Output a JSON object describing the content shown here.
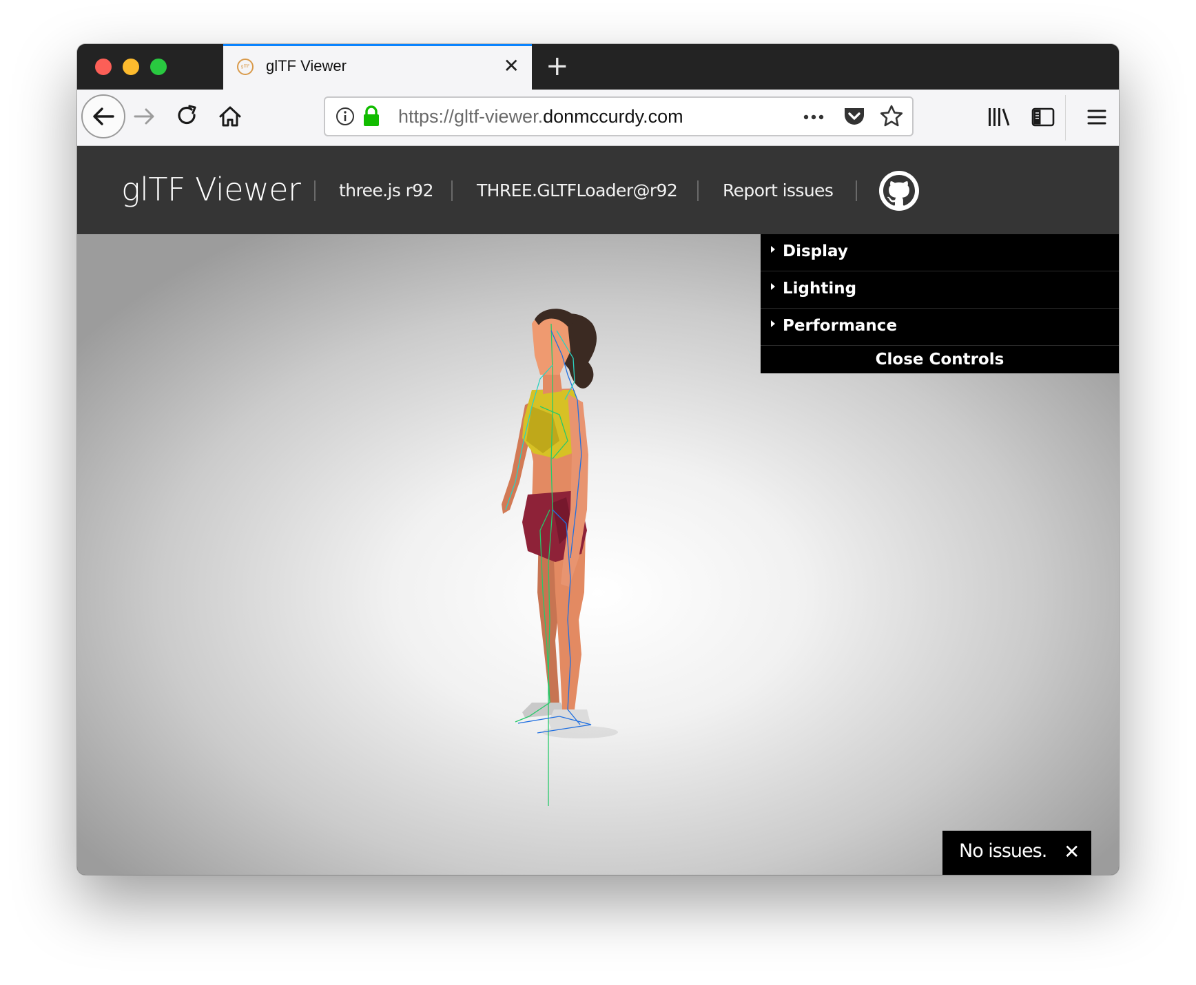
{
  "browser": {
    "tab": {
      "title": "glTF Viewer",
      "favicon_text": "glTF",
      "close_glyph": "✕"
    },
    "new_tab_glyph": "+",
    "url": {
      "prefix": "https://gltf-viewer.",
      "domain": "donmccurdy.com"
    },
    "toolbar_icons": [
      "back-arrow-icon",
      "forward-arrow-icon",
      "reload-icon",
      "home-icon",
      "info-icon",
      "lock-icon",
      "page-actions-icon",
      "pocket-icon",
      "bookmark-star-icon",
      "library-icon",
      "sidebar-icon",
      "menu-icon"
    ]
  },
  "site": {
    "title": "glTF Viewer",
    "nav": {
      "threejs": "three.js r92",
      "loader": "THREE.GLTFLoader@r92",
      "issues": "Report issues"
    }
  },
  "controls": {
    "folders": [
      "Display",
      "Lighting",
      "Performance"
    ],
    "close_label": "Close Controls"
  },
  "toast": {
    "message": "No issues.",
    "close_glyph": "✕"
  },
  "colors": {
    "tab_accent": "#0a84ff",
    "lock_green": "#12bc00",
    "header_bg": "#353535",
    "panel_bg": "#000000",
    "skin": "#e38a62",
    "top": "#d7c125",
    "shorts": "#8e2238",
    "hair": "#3b2a22"
  }
}
